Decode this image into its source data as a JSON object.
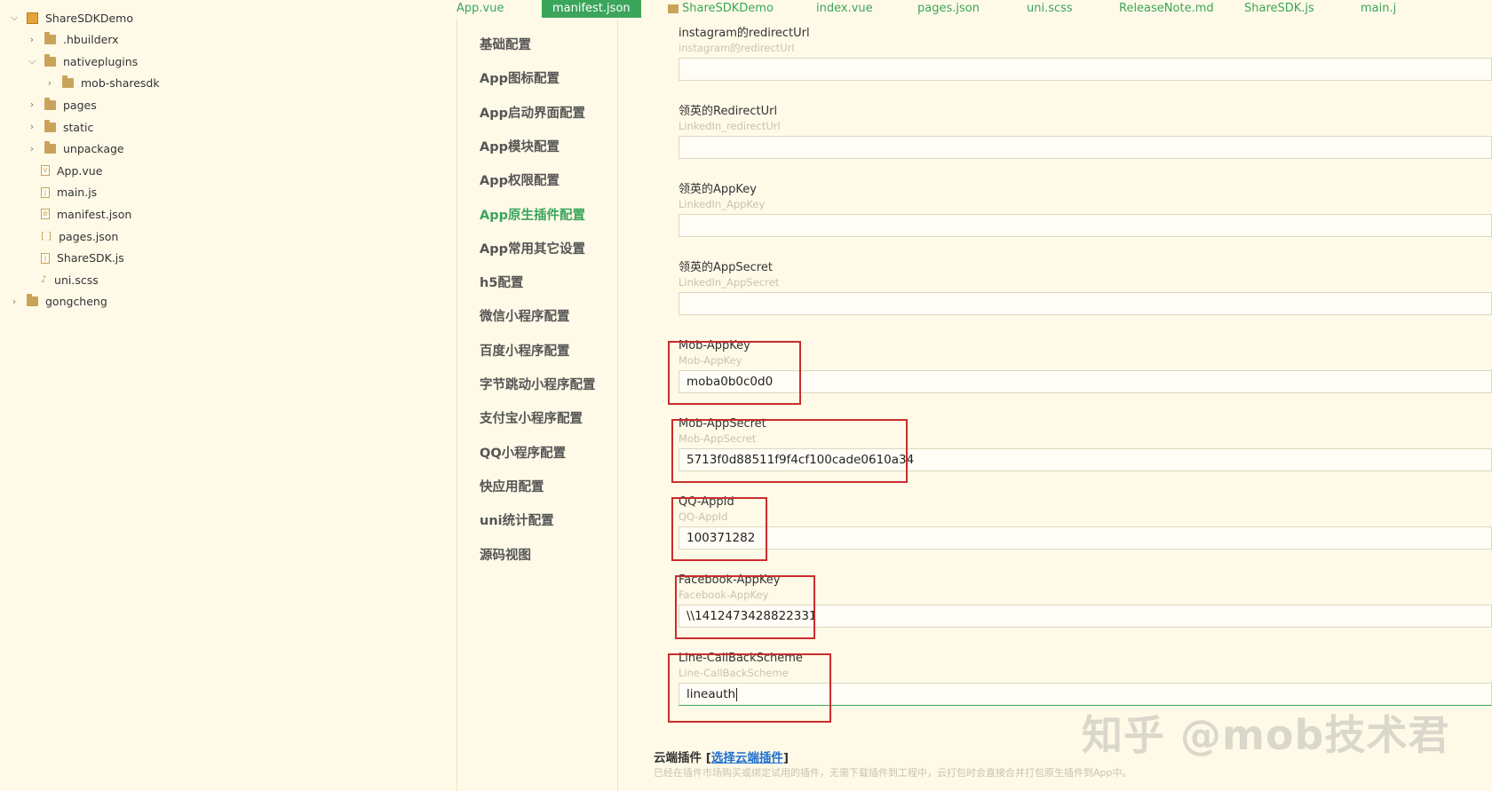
{
  "file_tree": [
    {
      "label": "ShareSDKDemo",
      "icon": "project-icon",
      "expanded": "down"
    },
    {
      "label": ".hbuilderx",
      "icon": "folder-icon",
      "expanded": "right"
    },
    {
      "label": "nativeplugins",
      "icon": "folder-icon",
      "expanded": "down"
    },
    {
      "label": "mob-sharesdk",
      "icon": "folder-icon",
      "expanded": "right"
    },
    {
      "label": "pages",
      "icon": "folder-icon",
      "expanded": "right"
    },
    {
      "label": "static",
      "icon": "folder-icon",
      "expanded": "right"
    },
    {
      "label": "unpackage",
      "icon": "folder-icon",
      "expanded": "right"
    },
    {
      "label": "App.vue",
      "icon": "vue-file-icon",
      "glyph": "V"
    },
    {
      "label": "main.js",
      "icon": "js-file-icon",
      "glyph": "J"
    },
    {
      "label": "manifest.json",
      "icon": "json-gear-file-icon",
      "glyph": "⚙"
    },
    {
      "label": "pages.json",
      "icon": "json-brackets-file-icon",
      "glyph": "[ ]"
    },
    {
      "label": "ShareSDK.js",
      "icon": "js-file-icon",
      "glyph": "J"
    },
    {
      "label": "uni.scss",
      "icon": "scss-file-icon",
      "glyph": "♪"
    },
    {
      "label": "gongcheng",
      "icon": "project-folder-icon",
      "expanded": "right"
    }
  ],
  "tabs": [
    {
      "label": "App.vue"
    },
    {
      "label": "manifest.json",
      "active": true
    },
    {
      "label": "ShareSDKDemo",
      "folder": true
    },
    {
      "label": "index.vue"
    },
    {
      "label": "pages.json"
    },
    {
      "label": "uni.scss"
    },
    {
      "label": "ReleaseNote.md"
    },
    {
      "label": "ShareSDK.js"
    },
    {
      "label": "main.j"
    }
  ],
  "nav": [
    {
      "label": "基础配置"
    },
    {
      "label": "App图标配置"
    },
    {
      "label": "App启动界面配置"
    },
    {
      "label": "App模块配置"
    },
    {
      "label": "App权限配置"
    },
    {
      "label": "App原生插件配置",
      "active": true
    },
    {
      "label": "App常用其它设置"
    },
    {
      "label": "h5配置"
    },
    {
      "label": "微信小程序配置"
    },
    {
      "label": "百度小程序配置"
    },
    {
      "label": "字节跳动小程序配置"
    },
    {
      "label": "支付宝小程序配置"
    },
    {
      "label": "QQ小程序配置"
    },
    {
      "label": "快应用配置"
    },
    {
      "label": "uni统计配置"
    },
    {
      "label": "源码视图"
    }
  ],
  "fields": [
    {
      "label": "instagram的redirectUrl",
      "hint": "instagram的redirectUrl",
      "value": ""
    },
    {
      "label": "领英的RedirectUrl",
      "hint": "LinkedIn_redirectUrl",
      "value": ""
    },
    {
      "label": "领英的AppKey",
      "hint": "LinkedIn_AppKey",
      "value": ""
    },
    {
      "label": "领英的AppSecret",
      "hint": "LinkedIn_AppSecret",
      "value": ""
    },
    {
      "label": "Mob-AppKey",
      "hint": "Mob-AppKey",
      "value": "moba0b0c0d0",
      "highlighted": true
    },
    {
      "label": "Mob-AppSecret",
      "hint": "Mob-AppSecret",
      "value": "5713f0d88511f9f4cf100cade0610a34",
      "highlighted": true
    },
    {
      "label": "QQ-AppId",
      "hint": "QQ-AppId",
      "value": "100371282",
      "highlighted": true
    },
    {
      "label": "Facebook-AppKey",
      "hint": "Facebook-AppKey",
      "value": "\\\\1412473428822331",
      "highlighted": true
    },
    {
      "label": "Line-CallBackScheme",
      "hint": "Line-CallBackScheme",
      "value": "lineauth",
      "highlighted": true,
      "focused": true
    }
  ],
  "cloud": {
    "title": "云端插件",
    "bracket_open": " [",
    "link": "选择云端插件",
    "bracket_close": "]",
    "desc": "已经在插件市场购买或绑定试用的插件，无需下载插件到工程中，云打包时会直接合并打包原生插件到App中。"
  },
  "watermark": "知乎 @mob技术君",
  "colors": {
    "accent": "#3ba55c",
    "highlight": "#c82d2d",
    "background": "#fffae8",
    "link": "#1e6fd0"
  }
}
